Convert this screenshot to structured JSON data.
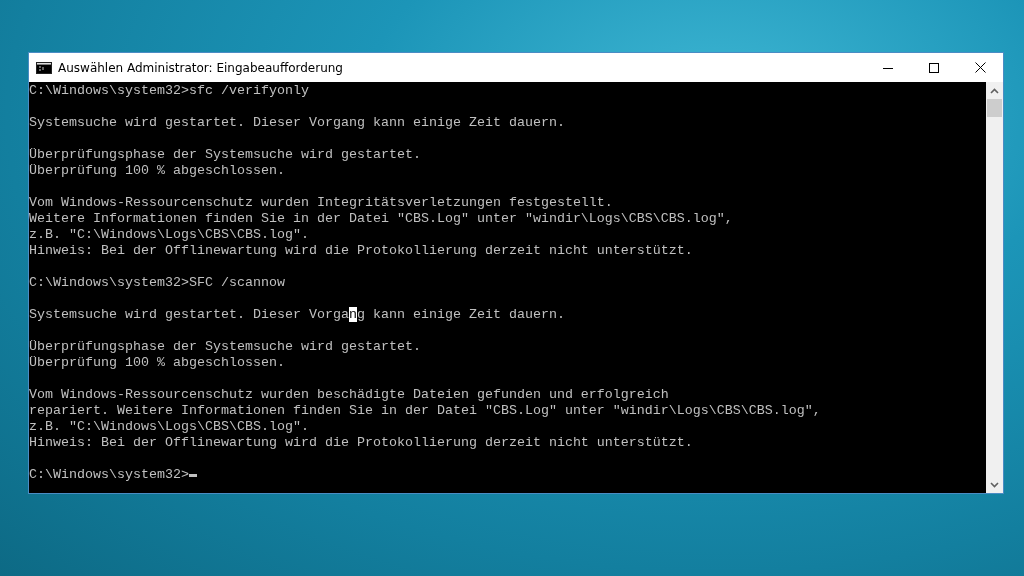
{
  "window": {
    "title": "Auswählen Administrator: Eingabeaufforderung"
  },
  "console": {
    "cursor_visible": true,
    "blocks": [
      [
        {
          "kind": "plain",
          "text": "C:\\Windows\\system32>sfc /verifyonly"
        }
      ],
      [
        {
          "kind": "plain",
          "text": "Systemsuche wird gestartet. Dieser Vorgang kann einige Zeit dauern."
        }
      ],
      [
        {
          "kind": "plain",
          "text": "Überprüfungsphase der Systemsuche wird gestartet."
        },
        {
          "kind": "plain",
          "text": "Überprüfung 100 % abgeschlossen."
        }
      ],
      [
        {
          "kind": "plain",
          "text": "Vom Windows-Ressourcenschutz wurden Integritätsverletzungen festgestellt."
        },
        {
          "kind": "plain",
          "text": "Weitere Informationen finden Sie in der Datei \"CBS.Log\" unter \"windir\\Logs\\CBS\\CBS.log\","
        },
        {
          "kind": "plain",
          "text": "z.B. \"C:\\Windows\\Logs\\CBS\\CBS.log\"."
        },
        {
          "kind": "plain",
          "text": "Hinweis: Bei der Offlinewartung wird die Protokollierung derzeit nicht unterstützt."
        }
      ],
      [
        {
          "kind": "plain",
          "text": "C:\\Windows\\system32>SFC /scannow"
        }
      ],
      [
        {
          "kind": "segmented",
          "segments": [
            {
              "text": "Systemsuche wird gestartet. Dieser Vorga",
              "selected": false
            },
            {
              "text": "n",
              "selected": true
            },
            {
              "text": "g kann einige Zeit dauern.",
              "selected": false
            }
          ]
        }
      ],
      [
        {
          "kind": "plain",
          "text": "Überprüfungsphase der Systemsuche wird gestartet."
        },
        {
          "kind": "plain",
          "text": "Überprüfung 100 % abgeschlossen."
        }
      ],
      [
        {
          "kind": "plain",
          "text": "Vom Windows-Ressourcenschutz wurden beschädigte Dateien gefunden und erfolgreich"
        },
        {
          "kind": "plain",
          "text": "repariert. Weitere Informationen finden Sie in der Datei \"CBS.Log\" unter \"windir\\Logs\\CBS\\CBS.log\","
        },
        {
          "kind": "plain",
          "text": "z.B. \"C:\\Windows\\Logs\\CBS\\CBS.log\"."
        },
        {
          "kind": "plain",
          "text": "Hinweis: Bei der Offlinewartung wird die Protokollierung derzeit nicht unterstützt."
        }
      ],
      [
        {
          "kind": "plain",
          "text": "C:\\Windows\\system32>"
        }
      ]
    ]
  }
}
